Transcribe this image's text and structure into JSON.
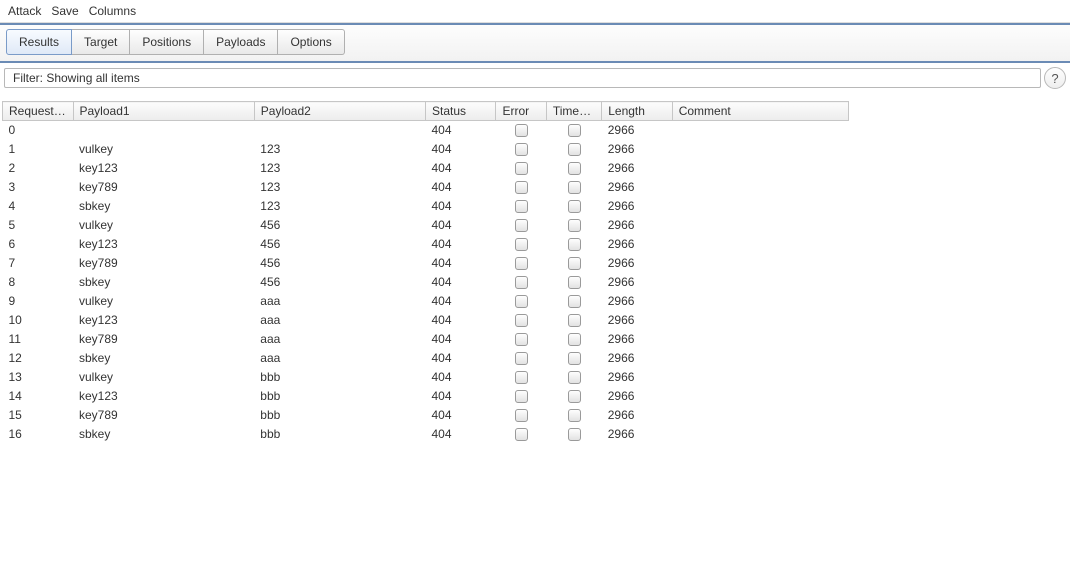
{
  "menu": {
    "attack": "Attack",
    "save": "Save",
    "columns": "Columns"
  },
  "tabs": {
    "results": "Results",
    "target": "Target",
    "positions": "Positions",
    "payloads": "Payloads",
    "options": "Options"
  },
  "filter": {
    "text": "Filter: Showing all items",
    "help": "?"
  },
  "headers": {
    "request": "Request",
    "payload1": "Payload1",
    "payload2": "Payload2",
    "status": "Status",
    "error": "Error",
    "timeout": "Timeout",
    "length": "Length",
    "comment": "Comment",
    "sort_arrow": "▲"
  },
  "rows": [
    {
      "req": "0",
      "p1": "",
      "p2": "",
      "status": "404",
      "len": "2966"
    },
    {
      "req": "1",
      "p1": "vulkey",
      "p2": "123",
      "status": "404",
      "len": "2966"
    },
    {
      "req": "2",
      "p1": "key123",
      "p2": "123",
      "status": "404",
      "len": "2966"
    },
    {
      "req": "3",
      "p1": "key789",
      "p2": "123",
      "status": "404",
      "len": "2966"
    },
    {
      "req": "4",
      "p1": "sbkey",
      "p2": "123",
      "status": "404",
      "len": "2966"
    },
    {
      "req": "5",
      "p1": "vulkey",
      "p2": "456",
      "status": "404",
      "len": "2966"
    },
    {
      "req": "6",
      "p1": "key123",
      "p2": "456",
      "status": "404",
      "len": "2966"
    },
    {
      "req": "7",
      "p1": "key789",
      "p2": "456",
      "status": "404",
      "len": "2966"
    },
    {
      "req": "8",
      "p1": "sbkey",
      "p2": "456",
      "status": "404",
      "len": "2966"
    },
    {
      "req": "9",
      "p1": "vulkey",
      "p2": "aaa",
      "status": "404",
      "len": "2966"
    },
    {
      "req": "10",
      "p1": "key123",
      "p2": "aaa",
      "status": "404",
      "len": "2966"
    },
    {
      "req": "11",
      "p1": "key789",
      "p2": "aaa",
      "status": "404",
      "len": "2966"
    },
    {
      "req": "12",
      "p1": "sbkey",
      "p2": "aaa",
      "status": "404",
      "len": "2966"
    },
    {
      "req": "13",
      "p1": "vulkey",
      "p2": "bbb",
      "status": "404",
      "len": "2966"
    },
    {
      "req": "14",
      "p1": "key123",
      "p2": "bbb",
      "status": "404",
      "len": "2966"
    },
    {
      "req": "15",
      "p1": "key789",
      "p2": "bbb",
      "status": "404",
      "len": "2966"
    },
    {
      "req": "16",
      "p1": "sbkey",
      "p2": "bbb",
      "status": "404",
      "len": "2966"
    }
  ]
}
